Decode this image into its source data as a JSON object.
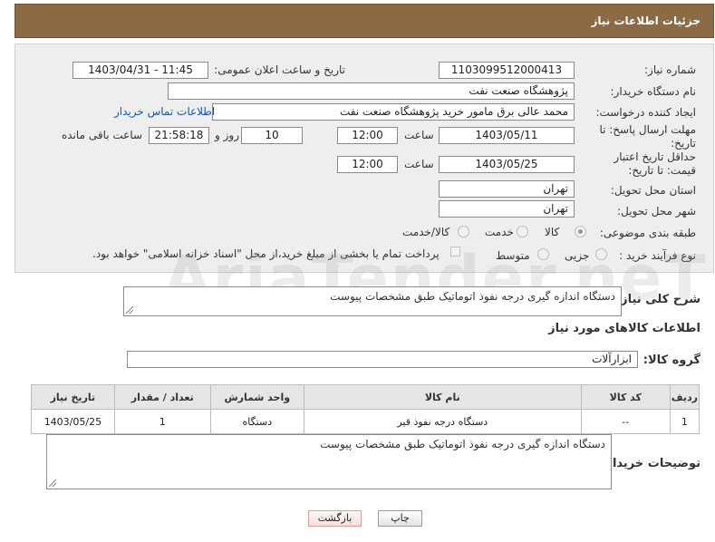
{
  "header": {
    "title": "جزئیات اطلاعات نیاز"
  },
  "form": {
    "need_number_label": "شماره نیاز:",
    "need_number": "1103099512000413",
    "announce_label": "تاریخ و ساعت اعلان عمومی:",
    "announce_value": "1403/04/31 - 11:45",
    "buyer_label": "نام دستگاه خریدار:",
    "buyer_value": "پژوهشگاه صنعت نفت",
    "creator_label": "ایجاد کننده درخواست:",
    "creator_value": "محمد عالی برق مامور خرید پژوهشگاه صنعت نفت",
    "contact_link": "اطلاعات تماس خریدار",
    "deadline_label": "مهلت ارسال پاسخ: تا تاریخ:",
    "deadline_date": "1403/05/11",
    "time_label": "ساعت",
    "deadline_time": "12:00",
    "days_value": "10",
    "days_label": "روز و",
    "remaining_value": "21:58:18",
    "remaining_label": "ساعت باقی مانده",
    "validity_label": "حداقل تاریخ اعتبار قیمت: تا تاریخ:",
    "validity_date": "1403/05/25",
    "validity_time": "12:00",
    "province_label": "استان محل تحویل:",
    "province_value": "تهران",
    "city_label": "شهر محل تحویل:",
    "city_value": "تهران",
    "category_label": "طبقه بندی موضوعی:",
    "category_options": [
      "کالا",
      "خدمت",
      "کالا/خدمت"
    ],
    "category_selected": "کالا",
    "process_label": "نوع فرآیند خرید :",
    "process_options": [
      "جزیی",
      "متوسط"
    ],
    "payment_text": "پرداخت تمام یا بخشی از مبلغ خرید،از محل \"اسناد خزانه اسلامی\" خواهد بود."
  },
  "summary": {
    "label": "شرح کلی نیاز:",
    "value": "دستگاه اندازه گیری درجه نفوذ اتوماتیک طبق مشخصات پیوست"
  },
  "goods": {
    "section_title": "اطلاعات کالاهای مورد نیاز",
    "group_label": "گروه کالا:",
    "group_value": "ابزارآلات",
    "columns": [
      "ردیف",
      "کد کالا",
      "نام کالا",
      "واحد شمارش",
      "تعداد / مقدار",
      "تاریخ نیاز"
    ],
    "rows": [
      [
        "1",
        "--",
        "دستگاه درجه نفوذ قیر",
        "دستگاه",
        "1",
        "1403/05/25"
      ]
    ]
  },
  "buyer_notes": {
    "label": "توضیحات خریدار:",
    "value": "دستگاه اندازه گیری درجه نفوذ اتوماتیک طبق مشخصات پیوست"
  },
  "buttons": {
    "print": "چاپ",
    "back": "بازگشت"
  },
  "watermark": "AriaTender.neT"
}
